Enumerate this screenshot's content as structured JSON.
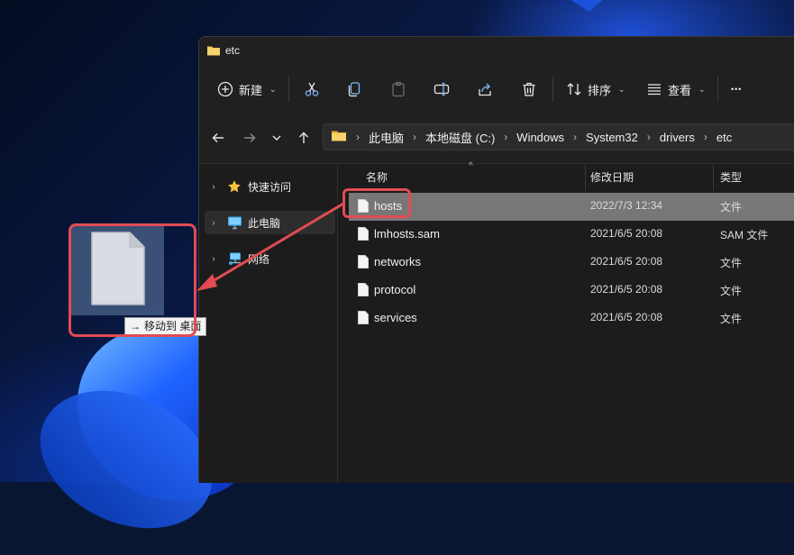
{
  "window": {
    "title": "etc"
  },
  "toolbar": {
    "new_label": "新建",
    "sort_label": "排序",
    "view_label": "查看",
    "more_label": "•••"
  },
  "address": {
    "crumbs": [
      "此电脑",
      "本地磁盘 (C:)",
      "Windows",
      "System32",
      "drivers",
      "etc"
    ],
    "separator": "›"
  },
  "sidebar": {
    "items": [
      {
        "label": "快速访问"
      },
      {
        "label": "此电脑"
      },
      {
        "label": "网络"
      }
    ]
  },
  "columns": {
    "name": "名称",
    "date": "修改日期",
    "type": "类型"
  },
  "files": [
    {
      "name": "hosts",
      "date": "2022/7/3 12:34",
      "type": "文件"
    },
    {
      "name": "lmhosts.sam",
      "date": "2021/6/5 20:08",
      "type": "SAM 文件"
    },
    {
      "name": "networks",
      "date": "2021/6/5 20:08",
      "type": "文件"
    },
    {
      "name": "protocol",
      "date": "2021/6/5 20:08",
      "type": "文件"
    },
    {
      "name": "services",
      "date": "2021/6/5 20:08",
      "type": "文件"
    }
  ],
  "drag": {
    "tip_arrow": "→",
    "tip_text": "移动到 桌面"
  },
  "colors": {
    "annotation": "#e24b53",
    "selection": "#777777",
    "folder": "#f2c14e"
  }
}
